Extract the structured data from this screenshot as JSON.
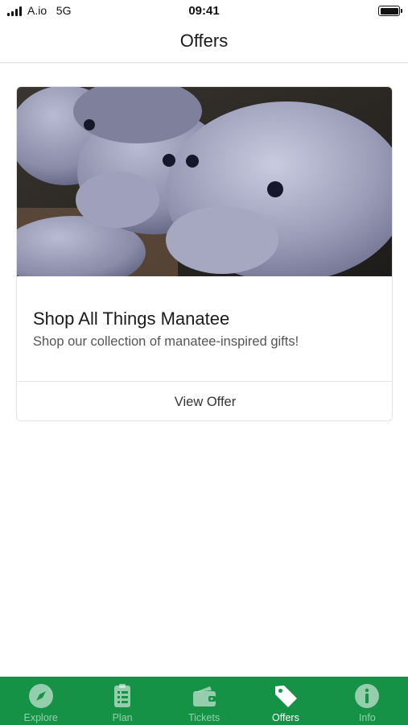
{
  "status_bar": {
    "carrier": "A.io",
    "network": "5G",
    "time": "09:41"
  },
  "header": {
    "title": "Offers"
  },
  "offers": [
    {
      "image": "plush-manatees-photo",
      "title": "Shop All Things Manatee",
      "description": "Shop our collection of manatee-inspired gifts!",
      "action_label": "View Offer"
    }
  ],
  "tab_bar": {
    "background": "#169247",
    "active_tab": "Offers",
    "tabs": [
      {
        "label": "Explore",
        "icon": "compass-icon"
      },
      {
        "label": "Plan",
        "icon": "checklist-icon"
      },
      {
        "label": "Tickets",
        "icon": "wallet-icon"
      },
      {
        "label": "Offers",
        "icon": "tag-icon"
      },
      {
        "label": "Info",
        "icon": "info-icon"
      }
    ]
  }
}
